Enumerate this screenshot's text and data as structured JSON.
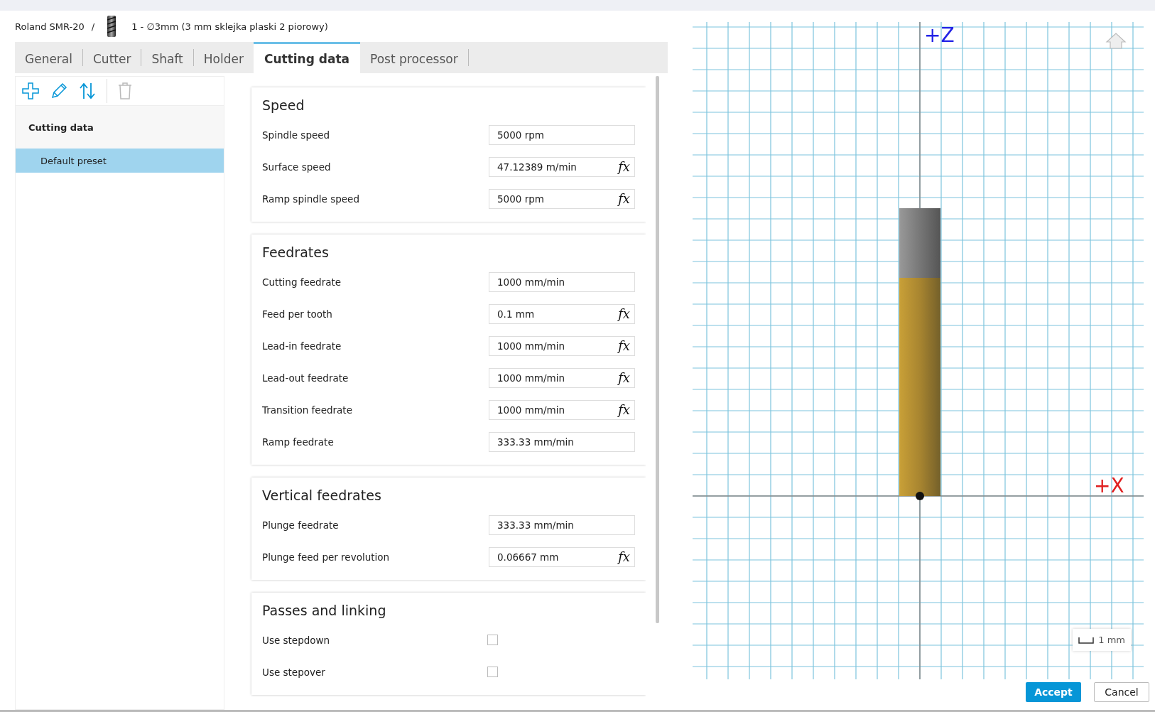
{
  "breadcrumb": {
    "machine": "Roland SMR-20",
    "separator": "/",
    "tool": "1 - ∅3mm (3 mm sklejka plaski 2 piorowy)"
  },
  "tabs": [
    {
      "label": "General",
      "selected": false
    },
    {
      "label": "Cutter",
      "selected": false
    },
    {
      "label": "Shaft",
      "selected": false
    },
    {
      "label": "Holder",
      "selected": false
    },
    {
      "label": "Cutting data",
      "selected": true
    },
    {
      "label": "Post processor",
      "selected": false
    }
  ],
  "sidebar": {
    "title": "Cutting data",
    "items": [
      {
        "label": "Default preset",
        "selected": true
      }
    ]
  },
  "sections": [
    {
      "title": "Speed",
      "fields": [
        {
          "kind": "input",
          "label": "Spindle speed",
          "value": "5000 rpm"
        },
        {
          "kind": "input",
          "label": "Surface speed",
          "value": "47.12389 m/min",
          "formula": "fx"
        },
        {
          "kind": "input",
          "label": "Ramp spindle speed",
          "value": "5000 rpm",
          "formula": "fx"
        }
      ]
    },
    {
      "title": "Feedrates",
      "fields": [
        {
          "kind": "input",
          "label": "Cutting feedrate",
          "value": "1000 mm/min"
        },
        {
          "kind": "input",
          "label": "Feed per tooth",
          "value": "0.1 mm",
          "formula": "fx"
        },
        {
          "kind": "input",
          "label": "Lead-in feedrate",
          "value": "1000 mm/min",
          "formula": "fx"
        },
        {
          "kind": "input",
          "label": "Lead-out feedrate",
          "value": "1000 mm/min",
          "formula": "fx"
        },
        {
          "kind": "input",
          "label": "Transition feedrate",
          "value": "1000 mm/min",
          "formula": "fx"
        },
        {
          "kind": "input",
          "label": "Ramp feedrate",
          "value": "333.33 mm/min"
        }
      ]
    },
    {
      "title": "Vertical feedrates",
      "fields": [
        {
          "kind": "input",
          "label": "Plunge feedrate",
          "value": "333.33 mm/min"
        },
        {
          "kind": "input",
          "label": "Plunge feed per revolution",
          "value": "0.06667 mm",
          "formula": "fx"
        }
      ]
    },
    {
      "title": "Passes and linking",
      "fields": [
        {
          "kind": "checkbox",
          "label": "Use stepdown",
          "checked": false
        },
        {
          "kind": "checkbox",
          "label": "Use stepover",
          "checked": false
        }
      ]
    }
  ],
  "viewport": {
    "z_label": "+Z",
    "x_label": "+X",
    "scale": "1 mm"
  },
  "buttons": {
    "accept": "Accept",
    "cancel": "Cancel"
  }
}
